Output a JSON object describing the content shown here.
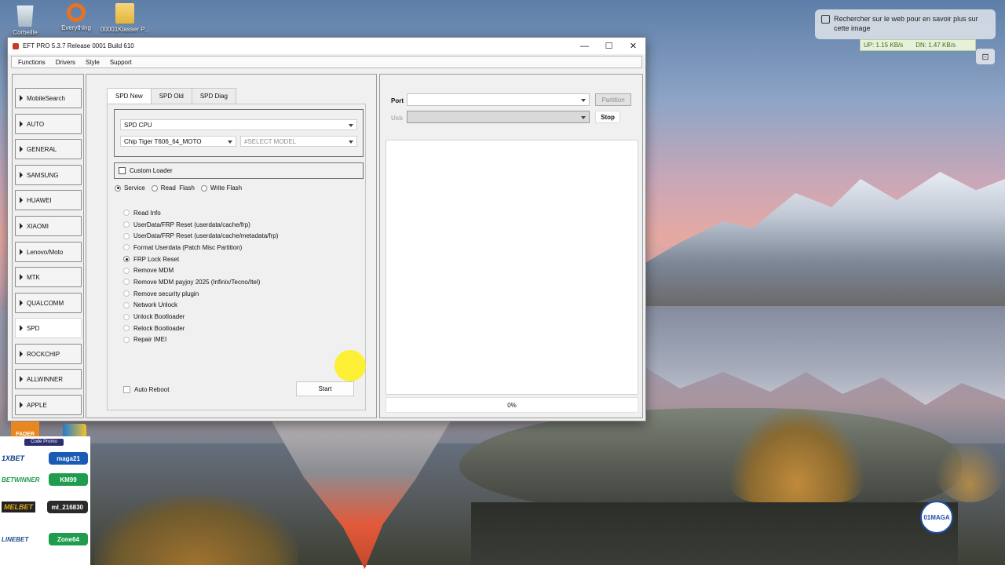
{
  "desktop": {
    "icons": [
      {
        "label": "Corbeille"
      },
      {
        "label": "Everything"
      },
      {
        "label": "00001Klasser P..."
      }
    ],
    "search_hint": "Rechercher sur le web pour en savoir plus sur cette image",
    "net": {
      "up": "UP: 1.15 KB/s",
      "down": "DN: 1.47 KB/s"
    }
  },
  "window": {
    "title": "EFT PRO 5.3.7 Release 0001 Build 610",
    "controls": {
      "minimize": "—",
      "maximize": "☐",
      "close": "✕"
    },
    "menu": [
      "Functions",
      "Drivers",
      "Style",
      "Support"
    ]
  },
  "sidebar": {
    "items": [
      {
        "label": "MobileSearch"
      },
      {
        "label": "AUTO"
      },
      {
        "label": "GENERAL"
      },
      {
        "label": "SAMSUNG"
      },
      {
        "label": "HUAWEI"
      },
      {
        "label": "XIAOMI"
      },
      {
        "label": "Lenovo/Moto"
      },
      {
        "label": "MTK"
      },
      {
        "label": "QUALCOMM"
      },
      {
        "label": "SPD"
      },
      {
        "label": "ROCKCHIP"
      },
      {
        "label": "ALLWINNER"
      },
      {
        "label": "APPLE"
      }
    ],
    "active": "SPD"
  },
  "center": {
    "tabs": [
      "SPD New",
      "SPD Old",
      "SPD Diag"
    ],
    "active_tab": "SPD New",
    "cpu_combo": "SPD CPU",
    "chip_combo": "Chip Tiger T606_64_MOTO",
    "model_combo": "#SELECT MODEL",
    "custom_loader": "Custom Loader",
    "modes": [
      "Service",
      "Read  Flash",
      "Write Flash"
    ],
    "selected_mode": "Service",
    "operations": [
      "Read Info",
      "UserData/FRP Reset (userdata/cache/frp)",
      "UserData/FRP Reset (userdata/cache/metadata/frp)",
      "Format Userdata (Patch Misc Partition)",
      "FRP Lock Reset",
      "Remove MDM",
      "Remove MDM payjoy 2025 (Infinix/Tecno/Itel)",
      "Remove security plugin",
      "Network Unlock",
      "Unlock Bootloader",
      "Relock Bootloader",
      "Repair IMEI"
    ],
    "selected_operation": "FRP Lock Reset",
    "auto_reboot": "Auto Reboot",
    "start": "Start"
  },
  "right": {
    "port_label": "Port",
    "usb_label": "Usb",
    "partition": "Partition",
    "stop": "Stop",
    "progress": "0%"
  },
  "ads": {
    "fader": "FADER",
    "promo_head": "Code Promo",
    "rows": [
      {
        "brand": "1XBET",
        "code": "maga21",
        "color": "#1a5bb5",
        "brand_color": "#0d3b86"
      },
      {
        "brand": "BETWINNER",
        "code": "KM99",
        "color": "#1f9c4d",
        "brand_color": "#1f9c4d"
      },
      {
        "brand": "MELBET",
        "code": "ml_216830",
        "color": "#2a2a2a",
        "brand_color": "#e0a81b"
      },
      {
        "brand": "LINEBET",
        "code": "Zone64",
        "color": "#1f9c4d",
        "brand_color": "#1d4b8f"
      }
    ],
    "badge": "01MAGA"
  }
}
